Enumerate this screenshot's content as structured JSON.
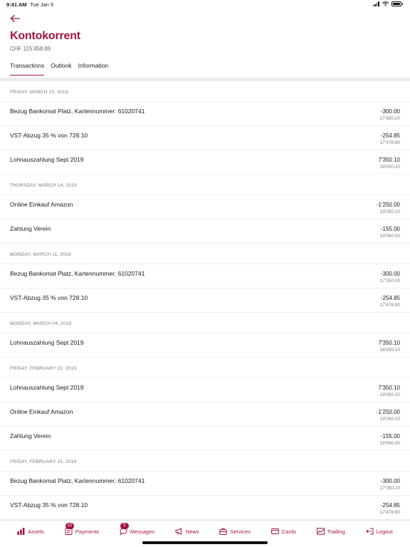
{
  "status": {
    "time": "9:41 AM",
    "date": "Tue Jan 9"
  },
  "header": {
    "back_icon": "arrow-left-icon",
    "title": "Kontokorrent",
    "balance": "CHF 115'458.85",
    "tabs": [
      {
        "label": "Transactions",
        "active": true
      },
      {
        "label": "Outlook",
        "active": false
      },
      {
        "label": "Information",
        "active": false
      }
    ]
  },
  "colors": {
    "accent": "#a41441"
  },
  "sections": [
    {
      "date": "FRIDAY, MARCH 15, 2019",
      "rows": [
        {
          "desc": "Bezug Bankomat Platz, Kartennummer: 61020741",
          "amount": "-300.00",
          "saldo": "17'350.20"
        },
        {
          "desc": "VST-Abzug 35 % von 728.10",
          "amount": "-254.85",
          "saldo": "17'478.90"
        },
        {
          "desc": "Lohnauszahlung Sept 2019",
          "amount": "7'350.10",
          "saldo": "18'050.10"
        }
      ]
    },
    {
      "date": "THURSDAY, MARCH 14, 2019",
      "rows": [
        {
          "desc": "Online Einkauf Amazon",
          "amount": "-1'250.00",
          "saldo": "19'250.10"
        },
        {
          "desc": "Zahlung Verein",
          "amount": "-155.00",
          "saldo": "19'560.00"
        }
      ]
    },
    {
      "date": "MONDAY, MARCH 11, 2019",
      "rows": [
        {
          "desc": "Bezug Bankomat Platz, Kartennummer: 61020741",
          "amount": "-300.00",
          "saldo": "17'350.20"
        },
        {
          "desc": "VST-Abzug 35 % von 728.10",
          "amount": "-254.85",
          "saldo": "17'478.90"
        }
      ]
    },
    {
      "date": "MONDAY, MARCH 04, 2019",
      "rows": [
        {
          "desc": "Lohnauszahlung Sept 2019",
          "amount": "7'350.10",
          "saldo": "18'050.10"
        }
      ]
    },
    {
      "date": "FRIDAY, FEBRUARY 22, 2019",
      "rows": [
        {
          "desc": "Lohnauszahlung Sept 2019",
          "amount": "7'350.10",
          "saldo": "18'050.10"
        },
        {
          "desc": "Online Einkauf Amazon",
          "amount": "-1'250.00",
          "saldo": "19'250.10"
        },
        {
          "desc": "Zahlung Verein",
          "amount": "-155.00",
          "saldo": "19'560.00"
        }
      ]
    },
    {
      "date": "FRIDAY, FEBRUARY 15, 2019",
      "rows": [
        {
          "desc": "Bezug Bankomat Platz, Kartennummer: 61020741",
          "amount": "-300.00",
          "saldo": "17'350.20"
        },
        {
          "desc": "VST-Abzug 35 % von 728.10",
          "amount": "-254.85",
          "saldo": "17'478.90"
        }
      ]
    }
  ],
  "tabbar": [
    {
      "label": "Assets",
      "icon": "bar-chart-icon"
    },
    {
      "label": "Payments",
      "icon": "payments-icon",
      "badge": "13"
    },
    {
      "label": "Messages",
      "icon": "chat-icon",
      "badge": "5"
    },
    {
      "label": "News",
      "icon": "megaphone-icon"
    },
    {
      "label": "Services",
      "icon": "briefcase-icon"
    },
    {
      "label": "Cards",
      "icon": "credit-card-icon"
    },
    {
      "label": "Trading",
      "icon": "trading-chart-icon"
    },
    {
      "label": "Logout",
      "icon": "logout-icon"
    }
  ]
}
